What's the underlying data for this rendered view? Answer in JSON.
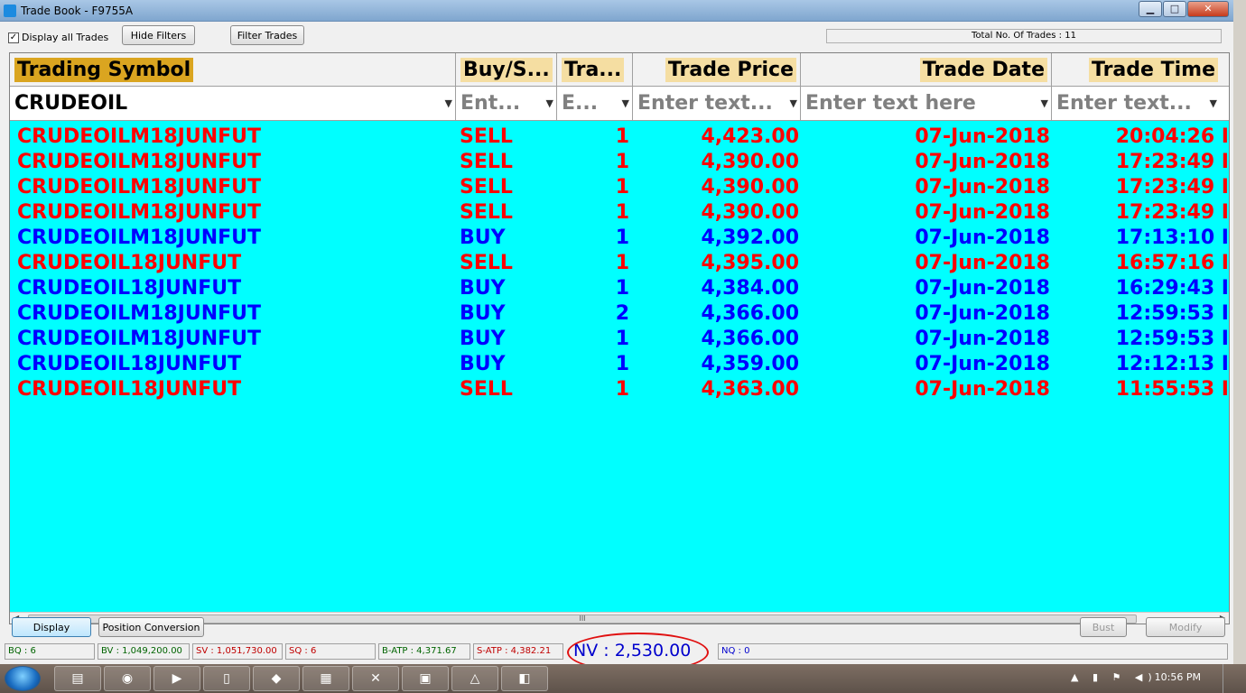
{
  "window": {
    "title": "Trade Book - F9755A",
    "min_icon": "minimize-icon",
    "max_icon": "maximize-icon",
    "close_label": "✕"
  },
  "toolbar": {
    "display_all_label": "Display all Trades",
    "display_all_checked": "✓",
    "hide_filters_label": "Hide Filters",
    "filter_trades_label": "Filter Trades",
    "total_trades": "Total No. Of Trades : 11"
  },
  "grid": {
    "columns": [
      {
        "header": "Trading Symbol",
        "filter": "CRUDEOIL"
      },
      {
        "header": "Buy/S...",
        "filter": "Ent..."
      },
      {
        "header": "Tra...",
        "filter": "E..."
      },
      {
        "header": "Trade Price",
        "filter": "Enter text..."
      },
      {
        "header": "Trade Date",
        "filter": "Enter text here"
      },
      {
        "header": "Trade Time",
        "filter": "Enter text..."
      }
    ],
    "rows": [
      {
        "symbol": "CRUDEOILM18JUNFUT",
        "side": "SELL",
        "qty": "1",
        "price": "4,423.00",
        "date": "07-Jun-2018",
        "time": "20:04:26 I"
      },
      {
        "symbol": "CRUDEOILM18JUNFUT",
        "side": "SELL",
        "qty": "1",
        "price": "4,390.00",
        "date": "07-Jun-2018",
        "time": "17:23:49 I"
      },
      {
        "symbol": "CRUDEOILM18JUNFUT",
        "side": "SELL",
        "qty": "1",
        "price": "4,390.00",
        "date": "07-Jun-2018",
        "time": "17:23:49 I"
      },
      {
        "symbol": "CRUDEOILM18JUNFUT",
        "side": "SELL",
        "qty": "1",
        "price": "4,390.00",
        "date": "07-Jun-2018",
        "time": "17:23:49 I"
      },
      {
        "symbol": "CRUDEOILM18JUNFUT",
        "side": "BUY",
        "qty": "1",
        "price": "4,392.00",
        "date": "07-Jun-2018",
        "time": "17:13:10 I"
      },
      {
        "symbol": "CRUDEOIL18JUNFUT",
        "side": "SELL",
        "qty": "1",
        "price": "4,395.00",
        "date": "07-Jun-2018",
        "time": "16:57:16 I"
      },
      {
        "symbol": "CRUDEOIL18JUNFUT",
        "side": "BUY",
        "qty": "1",
        "price": "4,384.00",
        "date": "07-Jun-2018",
        "time": "16:29:43 I"
      },
      {
        "symbol": "CRUDEOILM18JUNFUT",
        "side": "BUY",
        "qty": "2",
        "price": "4,366.00",
        "date": "07-Jun-2018",
        "time": "12:59:53 I"
      },
      {
        "symbol": "CRUDEOILM18JUNFUT",
        "side": "BUY",
        "qty": "1",
        "price": "4,366.00",
        "date": "07-Jun-2018",
        "time": "12:59:53 I"
      },
      {
        "symbol": "CRUDEOIL18JUNFUT",
        "side": "BUY",
        "qty": "1",
        "price": "4,359.00",
        "date": "07-Jun-2018",
        "time": "12:12:13 I"
      },
      {
        "symbol": "CRUDEOIL18JUNFUT",
        "side": "SELL",
        "qty": "1",
        "price": "4,363.00",
        "date": "07-Jun-2018",
        "time": "11:55:53 I"
      }
    ],
    "scroll_thumb_label": "III",
    "scroll_left": "◀",
    "scroll_right": "▶"
  },
  "buttons": {
    "display": "Display",
    "position_conversion": "Position Conversion",
    "bust": "Bust",
    "modify": "Modify"
  },
  "status": {
    "bq": "BQ : 6",
    "bv": "BV : 1,049,200.00",
    "sv": "SV : 1,051,730.00",
    "sq": "SQ : 6",
    "batp": "B-ATP : 4,371.67",
    "satp": "S-ATP : 4,382.21",
    "nv": "NV : 2,530.00",
    "nq": "NQ : 0"
  },
  "taskbar": {
    "clock": "10:56 PM",
    "tray_icons": "▲ ▮ ⚑ ◀)",
    "apps": [
      "▤",
      "◉",
      "▶",
      "▯",
      "◆",
      "▦",
      "✕",
      "▣",
      "△",
      "◧"
    ]
  },
  "colors": {
    "grid_bg": "#00ffff",
    "sell": "#ff0000",
    "buy": "#0000ff",
    "header_first": "#daa520",
    "header_other": "#f5dea2",
    "annotation": "#e01010"
  }
}
